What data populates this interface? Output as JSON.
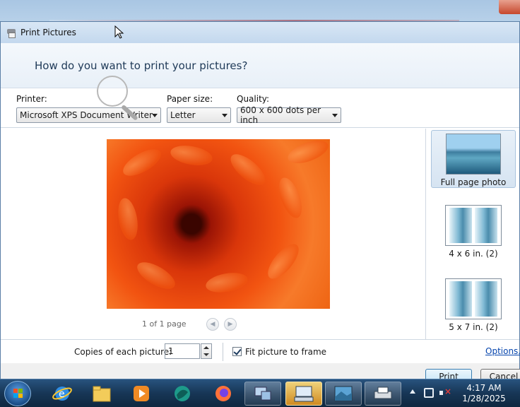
{
  "window": {
    "title": "Print Pictures"
  },
  "header": {
    "heading": "How do you want to print your pictures?"
  },
  "controls": {
    "printer": {
      "label": "Printer:",
      "value": "Microsoft XPS Document Writer"
    },
    "paper_size": {
      "label": "Paper size:",
      "value": "Letter"
    },
    "quality": {
      "label": "Quality:",
      "value": "600 x 600 dots per inch"
    }
  },
  "preview": {
    "page_info": "1 of 1 page"
  },
  "layouts": [
    {
      "label": "Full page photo",
      "selected": true
    },
    {
      "label": "4 x 6 in. (2)",
      "selected": false
    },
    {
      "label": "5 x 7 in. (2)",
      "selected": false
    }
  ],
  "bottom": {
    "copies_label": "Copies of each picture:",
    "copies_value": "1",
    "fit_label": "Fit picture to frame",
    "fit_checked": true,
    "options_link": "Options..."
  },
  "buttons": {
    "print": "Print",
    "cancel": "Cancel"
  },
  "taskbar": {
    "time": "4:17 AM",
    "date": "1/28/2025"
  },
  "icons": {
    "start": "windows-start-icon",
    "ie": "internet-explorer-icon",
    "folder": "file-explorer-icon",
    "media": "media-player-icon",
    "browser2": "globe-icon",
    "firefox": "firefox-icon"
  },
  "colors": {
    "accent": "#3c7fb1",
    "heading": "#1e3957",
    "link": "#0645ad"
  }
}
